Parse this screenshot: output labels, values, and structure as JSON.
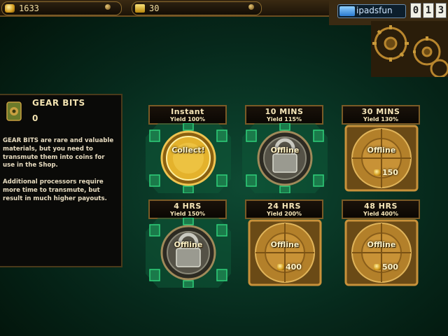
{
  "topbar": {
    "coins": "1633",
    "gold": "30",
    "watermark": "ipadsfun",
    "timer_digits": [
      "0",
      "1",
      "3"
    ]
  },
  "info": {
    "title": "GEAR BITS",
    "count": "0",
    "description": "GEAR BITS are rare and valuable\nmaterials, but you need to\ntransmute them into coins for\nuse in the Shop.\n\nAdditional processors require\nmore time to transmute, but\nresult in much higher payouts."
  },
  "processors": [
    {
      "name": "Instant",
      "yield": "Yield 100%",
      "status": "Collect!",
      "state": "collect",
      "price": ""
    },
    {
      "name": "10 MINS",
      "yield": "Yield 115%",
      "status": "Offline",
      "state": "locked",
      "price": ""
    },
    {
      "name": "30 MINS",
      "yield": "Yield 130%",
      "status": "Offline",
      "state": "buy",
      "price": "150"
    },
    {
      "name": "4 HRS",
      "yield": "Yield 150%",
      "status": "Offline",
      "state": "locked",
      "price": ""
    },
    {
      "name": "24 HRS",
      "yield": "Yield 200%",
      "status": "Offline",
      "state": "buy",
      "price": "400"
    },
    {
      "name": "48 HRS",
      "yield": "Yield 400%",
      "status": "Offline",
      "state": "buy",
      "price": "500"
    }
  ],
  "colors": {
    "background": "#06281b",
    "glow": "#2fd07a",
    "brass": "#c8913a",
    "text": "#f6e6b8"
  }
}
